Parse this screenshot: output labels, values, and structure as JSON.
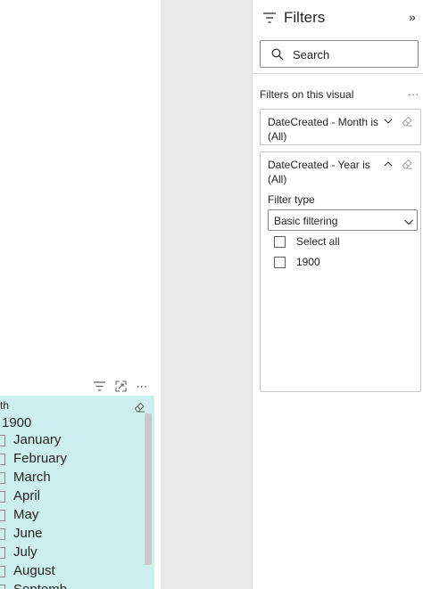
{
  "canvas": {
    "slicer": {
      "title": "th",
      "year": "1900",
      "months": [
        {
          "label": "January"
        },
        {
          "label": "February"
        },
        {
          "label": "March"
        },
        {
          "label": "April"
        },
        {
          "label": "May"
        },
        {
          "label": "June"
        },
        {
          "label": "July"
        },
        {
          "label": "August"
        },
        {
          "label": "Septemb"
        }
      ]
    }
  },
  "filters_pane": {
    "title": "Filters",
    "search": {
      "placeholder": "Search"
    },
    "section_label": "Filters on this visual",
    "section_more": "...",
    "cards": {
      "month": {
        "title": "DateCreated - Month is (All)",
        "expanded": false
      },
      "year": {
        "title": "DateCreated - Year is (All)",
        "expanded": true,
        "filter_type_label": "Filter type",
        "filter_type_value": "Basic filtering",
        "options": [
          {
            "label": "Select all",
            "checked": false
          },
          {
            "label": "1900",
            "checked": false
          }
        ]
      }
    }
  },
  "colors": {
    "slicer_background": "#cdeeee",
    "gutter": "#e9e9e9",
    "border": "#c8c6c4"
  }
}
